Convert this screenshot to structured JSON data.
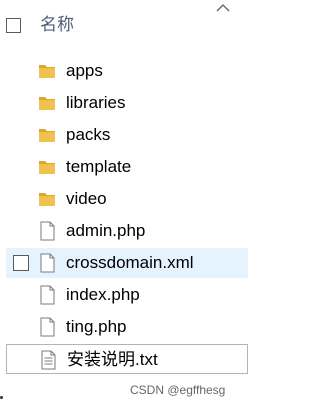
{
  "header": {
    "column_label": "名称"
  },
  "files": [
    {
      "name": "apps",
      "type": "folder",
      "icon": "folder-icon"
    },
    {
      "name": "libraries",
      "type": "folder",
      "icon": "folder-icon"
    },
    {
      "name": "packs",
      "type": "folder",
      "icon": "folder-icon"
    },
    {
      "name": "template",
      "type": "folder",
      "icon": "folder-icon"
    },
    {
      "name": "video",
      "type": "folder",
      "icon": "folder-icon"
    },
    {
      "name": "admin.php",
      "type": "file",
      "icon": "document-icon"
    },
    {
      "name": "crossdomain.xml",
      "type": "file",
      "icon": "document-icon",
      "selected": true
    },
    {
      "name": "index.php",
      "type": "file",
      "icon": "document-icon"
    },
    {
      "name": "ting.php",
      "type": "file",
      "icon": "document-icon"
    },
    {
      "name": "安装说明.txt",
      "type": "text",
      "icon": "text-document-icon",
      "focused": true
    }
  ],
  "watermark": "CSDN @egffhesg",
  "colors": {
    "folder": "#f0c24d",
    "folder_back": "#dca534",
    "selection": "#e5f3ff",
    "header_text": "#4d5f75"
  }
}
